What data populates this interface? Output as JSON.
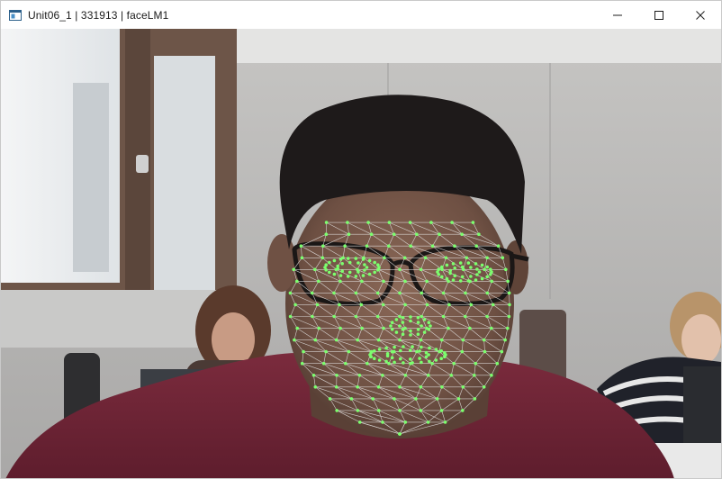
{
  "window": {
    "title": "Unit06_1 | 331913 | faceLM1",
    "icon": "app-window-icon",
    "controls": [
      {
        "name": "minimize-button",
        "icon": "minimize-icon"
      },
      {
        "name": "maximize-button",
        "icon": "maximize-icon"
      },
      {
        "name": "close-button",
        "icon": "close-icon"
      }
    ]
  },
  "viewport": {
    "content": "webcam-frame-with-face-mesh",
    "overlay_color": "#7cff6e",
    "mesh_line_color": "#e8e8e8"
  }
}
